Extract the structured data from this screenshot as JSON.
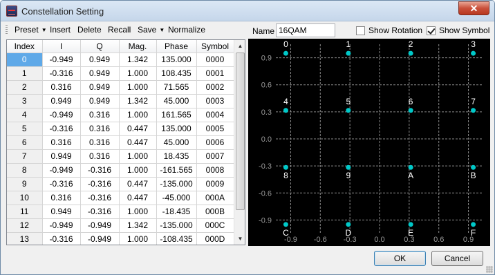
{
  "window": {
    "title": "Constellation Setting",
    "close_label": "✕"
  },
  "toolbar": {
    "preset": "Preset",
    "insert": "Insert",
    "delete": "Delete",
    "recall": "Recall",
    "save": "Save",
    "normalize": "Normalize"
  },
  "table": {
    "headers": [
      "Index",
      "I",
      "Q",
      "Mag.",
      "Phase",
      "Symbol"
    ],
    "selected_row": 0,
    "rows": [
      [
        "0",
        "-0.949",
        "0.949",
        "1.342",
        "135.000",
        "0000"
      ],
      [
        "1",
        "-0.316",
        "0.949",
        "1.000",
        "108.435",
        "0001"
      ],
      [
        "2",
        "0.316",
        "0.949",
        "1.000",
        "71.565",
        "0002"
      ],
      [
        "3",
        "0.949",
        "0.949",
        "1.342",
        "45.000",
        "0003"
      ],
      [
        "4",
        "-0.949",
        "0.316",
        "1.000",
        "161.565",
        "0004"
      ],
      [
        "5",
        "-0.316",
        "0.316",
        "0.447",
        "135.000",
        "0005"
      ],
      [
        "6",
        "0.316",
        "0.316",
        "0.447",
        "45.000",
        "0006"
      ],
      [
        "7",
        "0.949",
        "0.316",
        "1.000",
        "18.435",
        "0007"
      ],
      [
        "8",
        "-0.949",
        "-0.316",
        "1.000",
        "-161.565",
        "0008"
      ],
      [
        "9",
        "-0.316",
        "-0.316",
        "0.447",
        "-135.000",
        "0009"
      ],
      [
        "10",
        "0.316",
        "-0.316",
        "0.447",
        "-45.000",
        "000A"
      ],
      [
        "11",
        "0.949",
        "-0.316",
        "1.000",
        "-18.435",
        "000B"
      ],
      [
        "12",
        "-0.949",
        "-0.949",
        "1.342",
        "-135.000",
        "000C"
      ],
      [
        "13",
        "-0.316",
        "-0.949",
        "1.000",
        "-108.435",
        "000D"
      ]
    ]
  },
  "scrollbar": {
    "up": "▲",
    "down": "▼"
  },
  "settings": {
    "name_label": "Name",
    "name_value": "16QAM",
    "show_rotation_label": "Show Rotation",
    "show_rotation": false,
    "show_symbol_label": "Show Symbol",
    "show_symbol": true
  },
  "chart_data": {
    "type": "scatter",
    "x_ticks": [
      "-0.9",
      "-0.6",
      "-0.3",
      "0.0",
      "0.3",
      "0.6",
      "0.9"
    ],
    "y_ticks": [
      "0.9",
      "0.6",
      "0.3",
      "0.0",
      "-0.3",
      "-0.6",
      "-0.9"
    ],
    "xlim": [
      -1.05,
      1.05
    ],
    "ylim": [
      -1.05,
      1.05
    ],
    "grid": true,
    "point_color": "#00c8c8",
    "background": "#000000",
    "points": [
      {
        "label": "0",
        "x": -0.949,
        "y": 0.949
      },
      {
        "label": "1",
        "x": -0.316,
        "y": 0.949
      },
      {
        "label": "2",
        "x": 0.316,
        "y": 0.949
      },
      {
        "label": "3",
        "x": 0.949,
        "y": 0.949
      },
      {
        "label": "4",
        "x": -0.949,
        "y": 0.316
      },
      {
        "label": "5",
        "x": -0.316,
        "y": 0.316
      },
      {
        "label": "6",
        "x": 0.316,
        "y": 0.316
      },
      {
        "label": "7",
        "x": 0.949,
        "y": 0.316
      },
      {
        "label": "8",
        "x": -0.949,
        "y": -0.316
      },
      {
        "label": "9",
        "x": -0.316,
        "y": -0.316
      },
      {
        "label": "A",
        "x": 0.316,
        "y": -0.316
      },
      {
        "label": "B",
        "x": 0.949,
        "y": -0.316
      },
      {
        "label": "C",
        "x": -0.949,
        "y": -0.949
      },
      {
        "label": "D",
        "x": -0.316,
        "y": -0.949
      },
      {
        "label": "E",
        "x": 0.316,
        "y": -0.949
      },
      {
        "label": "F",
        "x": 0.949,
        "y": -0.949
      }
    ]
  },
  "buttons": {
    "ok": "OK",
    "cancel": "Cancel"
  }
}
